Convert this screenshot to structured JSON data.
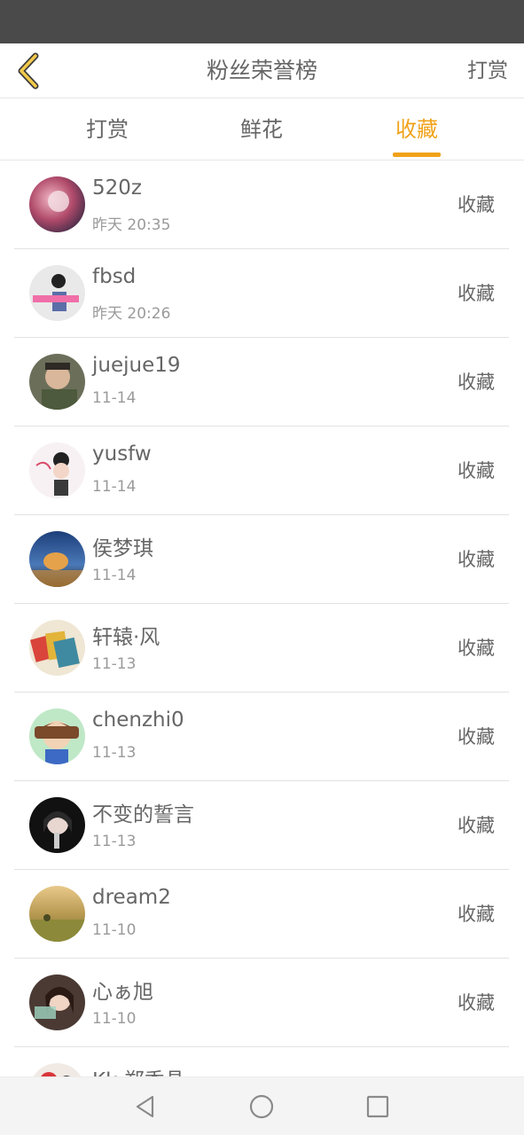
{
  "header": {
    "title": "粉丝荣誉榜",
    "action_label": "打赏"
  },
  "tabs": [
    {
      "label": "打赏",
      "active": false
    },
    {
      "label": "鲜花",
      "active": false
    },
    {
      "label": "收藏",
      "active": true
    }
  ],
  "colors": {
    "accent": "#f0a21a",
    "status_bar": "#4a4a4a"
  },
  "fans": [
    {
      "name": "520z",
      "time": "昨天 20:35",
      "action": "收藏"
    },
    {
      "name": "fbsd",
      "time": "昨天 20:26",
      "action": "收藏"
    },
    {
      "name": "juejue19",
      "time": "11-14",
      "action": "收藏"
    },
    {
      "name": "yusfw",
      "time": "11-14",
      "action": "收藏"
    },
    {
      "name": "侯梦琪",
      "time": "11-14",
      "action": "收藏"
    },
    {
      "name": "轩辕·风",
      "time": "11-13",
      "action": "收藏"
    },
    {
      "name": "chenzhi0",
      "time": "11-13",
      "action": "收藏"
    },
    {
      "name": "不变的誓言",
      "time": "11-13",
      "action": "收藏"
    },
    {
      "name": "dream2",
      "time": "11-10",
      "action": "收藏"
    },
    {
      "name": "心ぁ旭",
      "time": "11-10",
      "action": "收藏"
    },
    {
      "name": "Kk 郑秀晶",
      "time": "",
      "action": ""
    }
  ],
  "navigation": {
    "back": "back-triangle-icon",
    "home": "home-circle-icon",
    "recents": "recents-square-icon"
  }
}
